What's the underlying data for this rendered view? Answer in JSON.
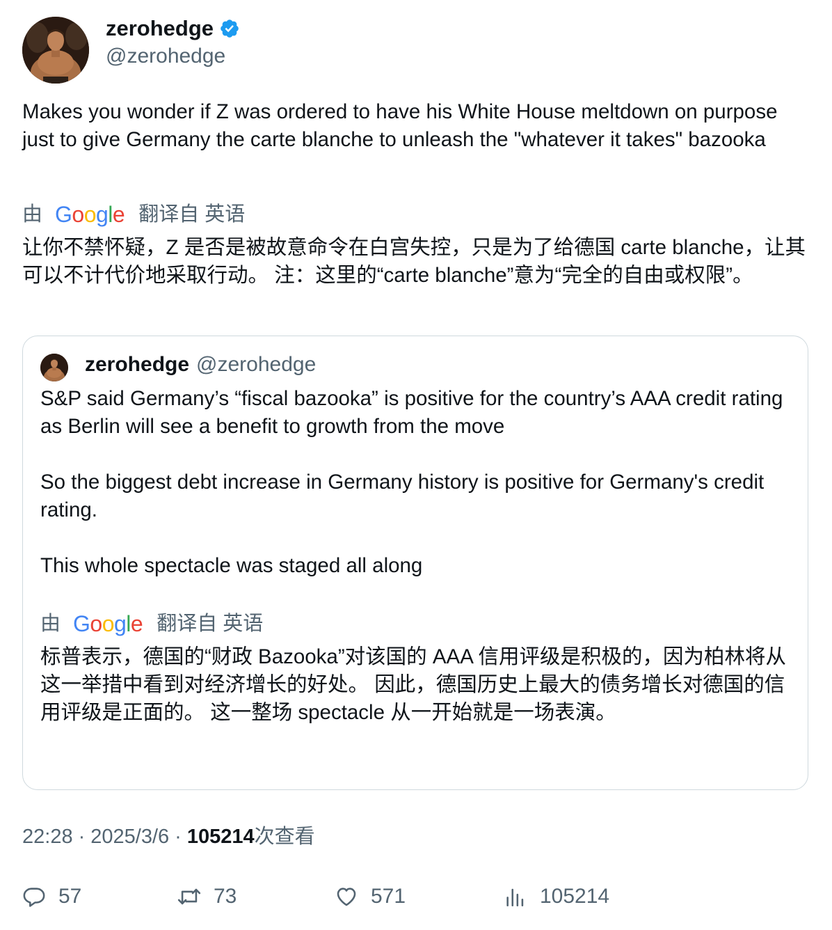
{
  "author": {
    "name": "zerohedge",
    "handle": "@zerohedge"
  },
  "tweet": {
    "text": "Makes you wonder if Z was ordered to have his White House meltdown on purpose just to give Germany the carte blanche to unleash the \"whatever it takes\" bazooka",
    "translation_prefix": "由",
    "translation_logo": "Google",
    "translation_suffix": "翻译自 英语",
    "translated_text": "让你不禁怀疑，Z 是否是被故意命令在白宫失控，只是为了给德国 carte blanche，让其可以不计代价地采取行动。 注：这里的“carte blanche”意为“完全的自由或权限”。"
  },
  "quoted": {
    "name": "zerohedge",
    "handle": "@zerohedge",
    "text": "S&P said Germany’s “fiscal bazooka” is positive for the country’s AAA credit rating as Berlin will see a benefit to growth from the move\n\nSo the biggest debt increase in Germany history is positive for Germany's credit rating.\n\nThis whole spectacle was staged all along",
    "translation_prefix": "由",
    "translation_logo": "Google",
    "translation_suffix": "翻译自 英语",
    "translated_text": "标普表示，德国的“财政 Bazooka”对该国的 AAA 信用评级是积极的，因为柏林将从这一举措中看到对经济增长的好处。 因此，德国历史上最大的债务增长对德国的信用评级是正面的。 这一整场 spectacle 从一开始就是一场表演。"
  },
  "meta": {
    "time": "22:28",
    "sep1": "·",
    "date": "2025/3/6",
    "sep2": "·",
    "views": "105214",
    "views_suffix": "次查看"
  },
  "actions": {
    "replies": "57",
    "retweets": "73",
    "likes": "571",
    "views": "105214"
  },
  "colors": {
    "verified": "#1d9bf0",
    "secondary_text": "#536471",
    "border": "#cfd9de"
  }
}
